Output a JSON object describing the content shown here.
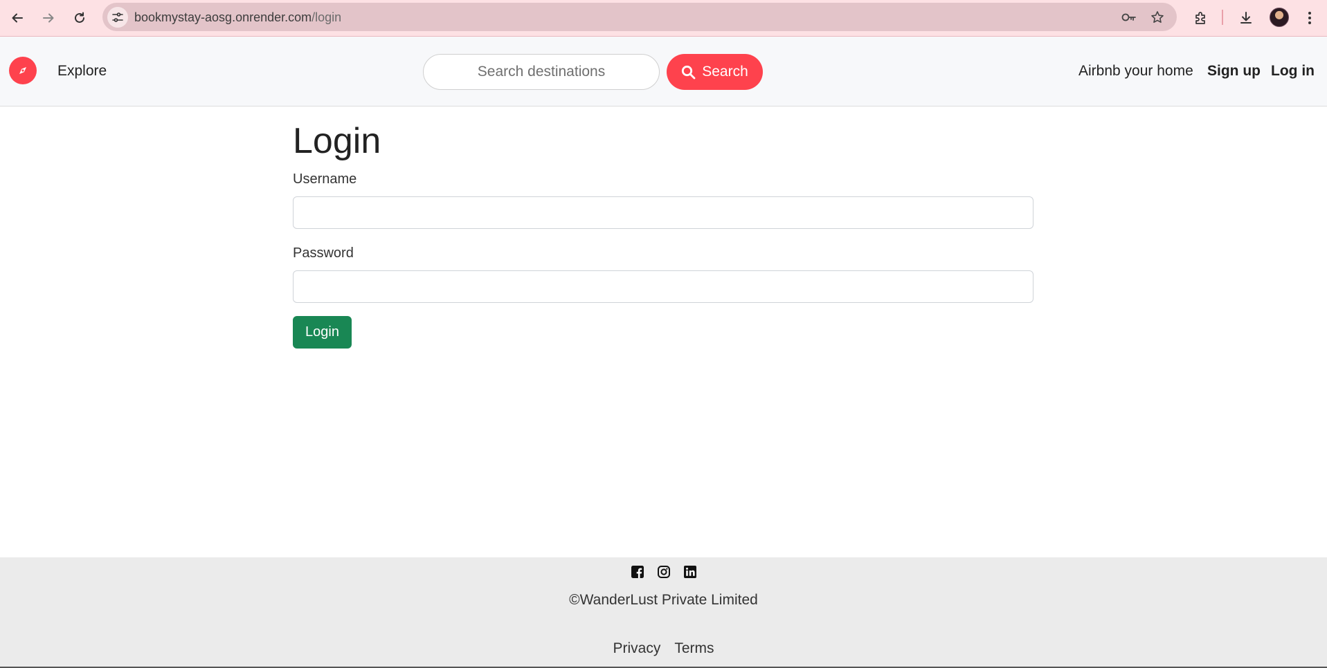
{
  "browser": {
    "url_host": "bookmystay-aosg.onrender.com",
    "url_path": "/login",
    "icons": [
      "back-icon",
      "forward-icon",
      "reload-icon",
      "site-info-icon",
      "password-key-icon",
      "bookmark-star-icon",
      "extensions-icon",
      "download-icon",
      "profile-avatar",
      "more-menu-icon"
    ]
  },
  "navbar": {
    "explore_label": "Explore",
    "search_placeholder": "Search destinations",
    "search_button_label": "Search",
    "host_link": "Airbnb your home",
    "signup_link": "Sign up",
    "login_link": "Log in",
    "brand_color": "#fe424d"
  },
  "form": {
    "title": "Login",
    "username_label": "Username",
    "username_value": "",
    "password_label": "Password",
    "password_value": "",
    "submit_label": "Login",
    "submit_color": "#198754"
  },
  "footer": {
    "social_icons": [
      "facebook-icon",
      "instagram-icon",
      "linkedin-icon"
    ],
    "copyright": "©WanderLust Private Limited",
    "links": [
      "Privacy",
      "Terms"
    ]
  }
}
